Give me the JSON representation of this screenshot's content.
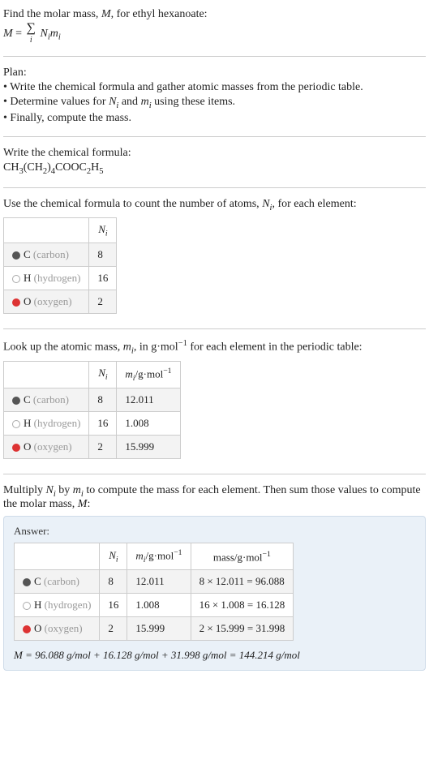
{
  "intro": {
    "line1_a": "Find the molar mass, ",
    "line1_m": "M",
    "line1_b": ", for ethyl hexanoate:",
    "eq_lhs": "M",
    "eq_eq": " = ",
    "eq_sum_idx": "i",
    "eq_rhs_n": "N",
    "eq_rhs_i": "i",
    "eq_rhs_m": "m",
    "eq_rhs_i2": "i"
  },
  "plan": {
    "title": "Plan:",
    "b1": "• Write the chemical formula and gather atomic masses from the periodic table.",
    "b2a": "• Determine values for ",
    "b2_n": "N",
    "b2_i": "i",
    "b2_and": " and ",
    "b2_m": "m",
    "b2_i2": "i",
    "b2_end": " using these items.",
    "b3": "• Finally, compute the mass."
  },
  "chem": {
    "title": "Write the chemical formula:",
    "formula_plain": "CH3(CH2)4COOC2H5"
  },
  "count": {
    "title_a": "Use the chemical formula to count the number of atoms, ",
    "title_n": "N",
    "title_i": "i",
    "title_b": ", for each element:",
    "col_n": "N",
    "col_i": "i",
    "rows": [
      {
        "swatch": "c",
        "sym": "C",
        "name": " (carbon)",
        "n": "8"
      },
      {
        "swatch": "h",
        "sym": "H",
        "name": " (hydrogen)",
        "n": "16"
      },
      {
        "swatch": "o",
        "sym": "O",
        "name": " (oxygen)",
        "n": "2"
      }
    ]
  },
  "masses": {
    "title_a": "Look up the atomic mass, ",
    "title_m": "m",
    "title_i": "i",
    "title_b": ", in g·mol",
    "title_exp": "−1",
    "title_c": " for each element in the periodic table:",
    "col_n": "N",
    "col_ni": "i",
    "col_m": "m",
    "col_mi": "i",
    "col_unit": "/g·mol",
    "col_exp": "−1",
    "rows": [
      {
        "swatch": "c",
        "sym": "C",
        "name": " (carbon)",
        "n": "8",
        "m": "12.011"
      },
      {
        "swatch": "h",
        "sym": "H",
        "name": " (hydrogen)",
        "n": "16",
        "m": "1.008"
      },
      {
        "swatch": "o",
        "sym": "O",
        "name": " (oxygen)",
        "n": "2",
        "m": "15.999"
      }
    ]
  },
  "compute": {
    "text_a": "Multiply ",
    "n": "N",
    "ni": "i",
    "text_b": " by ",
    "m": "m",
    "mi": "i",
    "text_c": " to compute the mass for each element. Then sum those values to compute the molar mass, ",
    "M": "M",
    "text_d": ":"
  },
  "answer": {
    "label": "Answer:",
    "col_n": "N",
    "col_ni": "i",
    "col_m": "m",
    "col_mi": "i",
    "col_munit": "/g·mol",
    "col_mexp": "−1",
    "col_mass": "mass/g·mol",
    "col_massexp": "−1",
    "rows": [
      {
        "swatch": "c",
        "sym": "C",
        "name": " (carbon)",
        "n": "8",
        "m": "12.011",
        "calc": "8 × 12.011 = 96.088"
      },
      {
        "swatch": "h",
        "sym": "H",
        "name": " (hydrogen)",
        "n": "16",
        "m": "1.008",
        "calc": "16 × 1.008 = 16.128"
      },
      {
        "swatch": "o",
        "sym": "O",
        "name": " (oxygen)",
        "n": "2",
        "m": "15.999",
        "calc": "2 × 15.999 = 31.998"
      }
    ],
    "final_M": "M",
    "final_eq": " = 96.088 g/mol + 16.128 g/mol + 31.998 g/mol = 144.214 g/mol"
  }
}
